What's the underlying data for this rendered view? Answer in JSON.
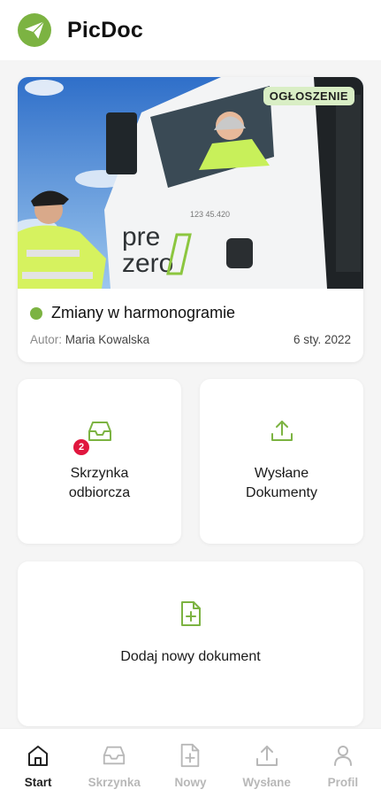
{
  "app": {
    "title": "PicDoc"
  },
  "news": {
    "badge": "OGŁOSZENIE",
    "title": "Zmiany w harmonogramie",
    "author_prefix": "Autor:",
    "author": "Maria Kowalska",
    "date": "6 sty. 2022",
    "photo_text": {
      "brand_line1": "pre",
      "brand_line2": "zero",
      "plate": "123 45.420"
    }
  },
  "tiles": {
    "inbox": {
      "line1": "Skrzynka",
      "line2": "odbiorcza",
      "count": "2"
    },
    "sent": {
      "line1": "Wysłane",
      "line2": "Dokumenty"
    },
    "new_doc": {
      "label": "Dodaj nowy dokument"
    }
  },
  "tabs": [
    {
      "label": "Start",
      "icon": "home-icon",
      "active": true
    },
    {
      "label": "Skrzynka",
      "icon": "inbox-icon",
      "active": false
    },
    {
      "label": "Nowy",
      "icon": "new-document-icon",
      "active": false
    },
    {
      "label": "Wysłane",
      "icon": "upload-icon",
      "active": false
    },
    {
      "label": "Profil",
      "icon": "profile-icon",
      "active": false
    }
  ],
  "colors": {
    "accent": "#7cb342",
    "badge_bg": "#d9eec5",
    "notification": "#e0163e",
    "inactive_tab": "#b8b8b8"
  }
}
